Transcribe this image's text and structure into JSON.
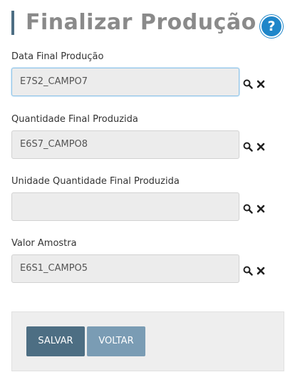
{
  "page": {
    "title": "Finalizar Produção",
    "help_icon": "help-circle-icon",
    "help_glyph": "?"
  },
  "fields": [
    {
      "label": "Data Final Produção",
      "value": "E7S2_CAMPO7"
    },
    {
      "label": "Quantidade Final Produzida",
      "value": "E6S7_CAMPO8"
    },
    {
      "label": "Unidade Quantidade Final Produzida",
      "value": ""
    },
    {
      "label": "Valor Amostra",
      "value": "E6S1_CAMPO5"
    }
  ],
  "buttons": {
    "save_label": "SALVAR",
    "back_label": "VOLTAR"
  },
  "colors": {
    "accent": "#4d6e83",
    "help": "#1f86c9",
    "secondary": "#7a9cb4"
  }
}
